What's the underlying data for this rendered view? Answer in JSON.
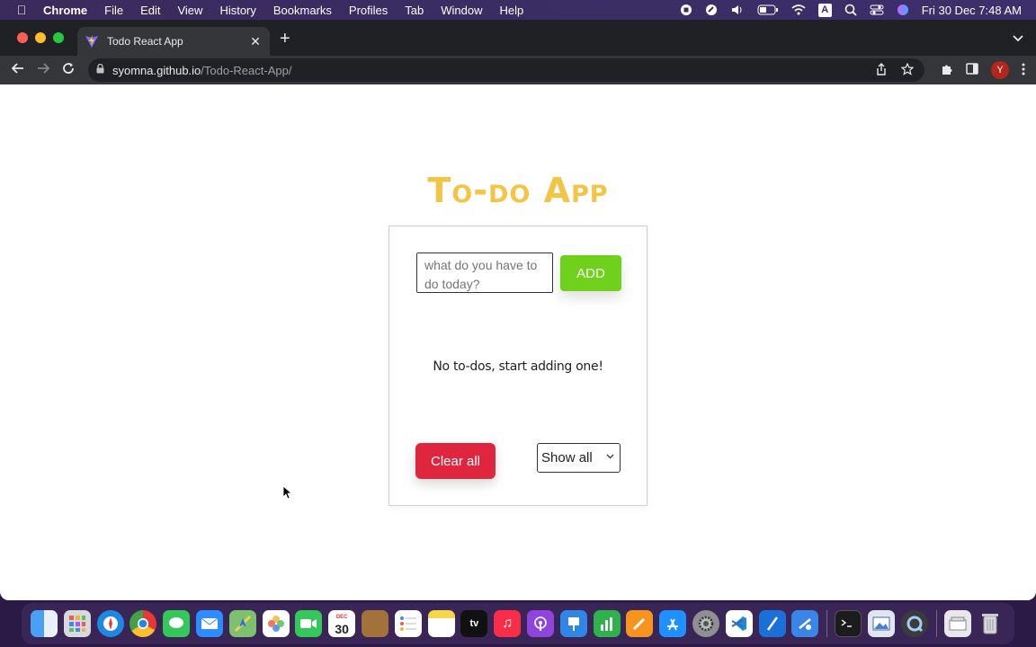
{
  "menubar": {
    "apple_icon": "apple-logo",
    "app_name": "Chrome",
    "items": [
      "File",
      "Edit",
      "View",
      "History",
      "Bookmarks",
      "Profiles",
      "Tab",
      "Window",
      "Help"
    ],
    "status_icons": [
      "record-icon",
      "cast-icon",
      "volume-icon",
      "battery-icon",
      "wifi-icon",
      "input-A-icon",
      "search-icon",
      "control-center-icon",
      "siri-icon"
    ],
    "input_source_label": "A",
    "clock": "Fri 30 Dec  7:48 AM"
  },
  "browser": {
    "tab_title": "Todo React App",
    "new_tab_label": "+",
    "url_host": "syomna.github.io",
    "url_path": "/Todo-React-App/",
    "profile_initial": "Y",
    "colors": {
      "frame": "#202124",
      "toolbar": "#35363a",
      "profile": "#b3261e"
    }
  },
  "app": {
    "title": "To-do App",
    "input_placeholder": "what do you have to do today?",
    "add_label": "ADD",
    "empty_message": "No to-dos, start adding one!",
    "clear_label": "Clear all",
    "filter_selected": "Show all",
    "colors": {
      "title": "#f3c544",
      "add": "#6fd11c",
      "clear": "#e0263f"
    }
  },
  "dock": {
    "apps": [
      "finder",
      "launchpad",
      "safari",
      "chrome",
      "messages",
      "mail",
      "maps",
      "photos",
      "facetime",
      "calendar",
      "notes-brown",
      "reminders",
      "notes",
      "apple-tv",
      "music",
      "podcasts",
      "keynote",
      "numbers",
      "pages",
      "app-store",
      "system-preferences",
      "vscode",
      "xcode-tools",
      "simulator",
      "terminal",
      "preview",
      "quicktime",
      "downloads",
      "trash"
    ],
    "calendar_day": "30",
    "calendar_month": "DEC",
    "tv_label": "tv"
  }
}
